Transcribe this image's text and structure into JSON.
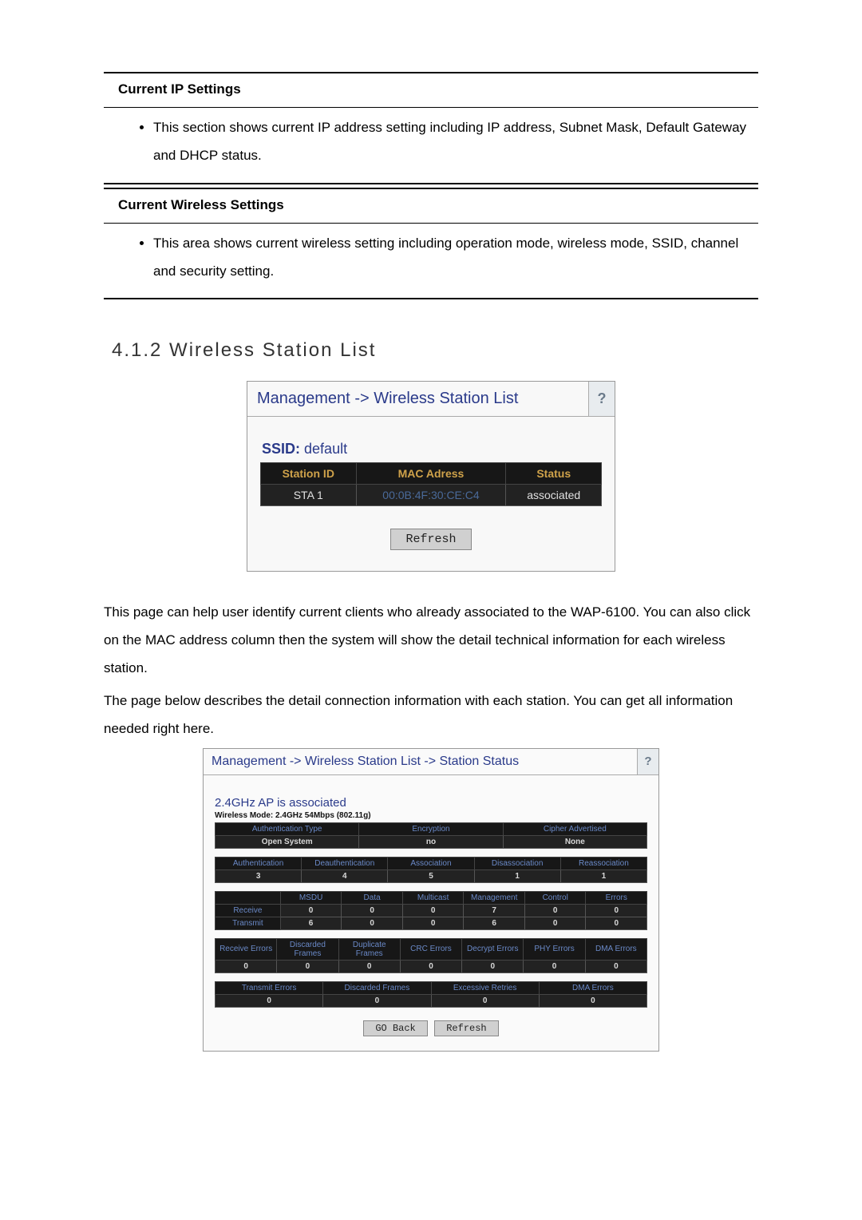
{
  "sections": [
    {
      "title": "Current IP Settings",
      "bullet": "This section shows current IP address setting including IP address, Subnet Mask, Default Gateway and DHCP status."
    },
    {
      "title": "Current Wireless Settings",
      "bullet": "This area shows current wireless setting including operation mode, wireless mode, SSID, channel and security setting."
    }
  ],
  "heading": "4.1.2 Wireless Station List",
  "shot1": {
    "crumb1": "Management",
    "crumb2": "Wireless Station List",
    "help": "?",
    "ssid_label": "SSID:",
    "ssid_value": "default",
    "headers": [
      "Station ID",
      "MAC Adress",
      "Status"
    ],
    "row": {
      "id": "STA 1",
      "mac": "00:0B:4F:30:CE:C4",
      "status": "associated"
    },
    "refresh": "Refresh"
  },
  "paras": [
    "This page can help user identify current clients who already associated to the WAP-6100. You can also click on the MAC address column then the system will show the detail technical information for each wireless station.",
    "The page below describes the detail connection information with each station. You can get all information needed right here."
  ],
  "shot2": {
    "crumb1": "Management",
    "crumb2": "Wireless Station List",
    "crumb3": "Station Status",
    "help": "?",
    "ap_line": "2.4GHz AP is  associated",
    "mode_line": "Wireless Mode: 2.4GHz 54Mbps (802.11g)",
    "t_auth": {
      "headers": [
        "Authentication Type",
        "Encryption",
        "Cipher Advertised"
      ],
      "row": [
        "Open System",
        "no",
        "None"
      ]
    },
    "t_counts": {
      "headers": [
        "Authentication",
        "Deauthentication",
        "Association",
        "Disassociation",
        "Reassociation"
      ],
      "row": [
        "3",
        "4",
        "5",
        "1",
        "1"
      ]
    },
    "t_rx": {
      "cols": [
        "MSDU",
        "Data",
        "Multicast",
        "Management",
        "Control",
        "Errors"
      ],
      "rows": [
        {
          "label": "Receive",
          "vals": [
            "0",
            "0",
            "0",
            "7",
            "0",
            "0"
          ]
        },
        {
          "label": "Transmit",
          "vals": [
            "6",
            "0",
            "0",
            "6",
            "0",
            "0"
          ]
        }
      ]
    },
    "t_rxerr": {
      "headers": [
        "Receive Errors",
        "Discarded Frames",
        "Duplicate Frames",
        "CRC Errors",
        "Decrypt Errors",
        "PHY Errors",
        "DMA Errors"
      ],
      "row": [
        "0",
        "0",
        "0",
        "0",
        "0",
        "0",
        "0"
      ]
    },
    "t_txerr": {
      "headers": [
        "Transmit Errors",
        "Discarded Frames",
        "Excessive Retries",
        "DMA Errors"
      ],
      "row": [
        "0",
        "0",
        "0",
        "0"
      ]
    },
    "go_back": "GO Back",
    "refresh": "Refresh"
  }
}
